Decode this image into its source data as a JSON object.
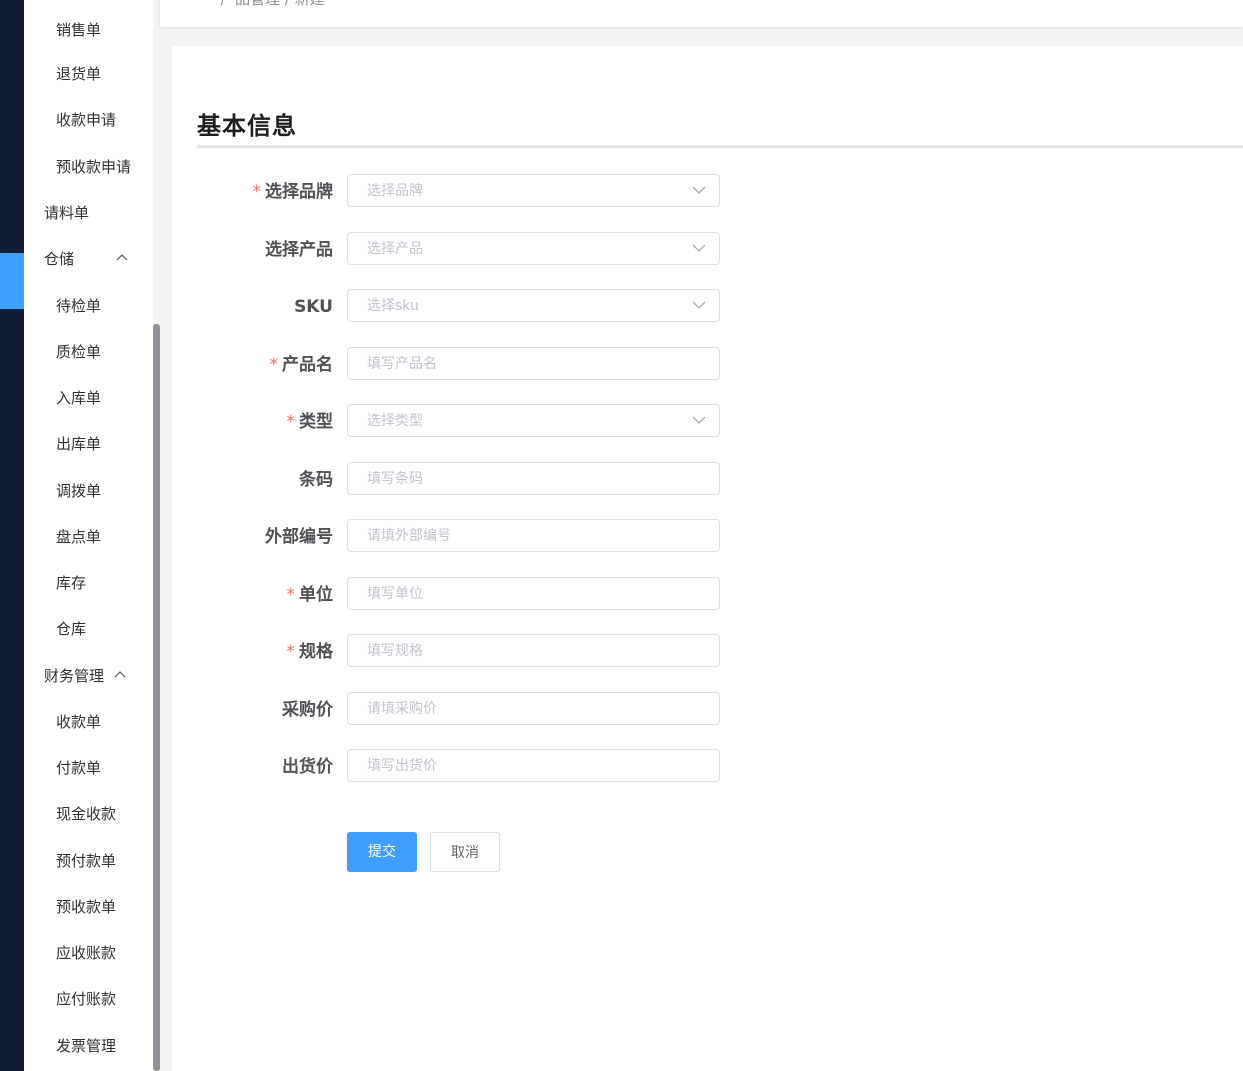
{
  "sidebar": {
    "items": [
      {
        "label": "销售单",
        "level": "sub"
      },
      {
        "label": "退货单",
        "level": "sub"
      },
      {
        "label": "收款申请",
        "level": "sub"
      },
      {
        "label": "预收款申请",
        "level": "sub"
      },
      {
        "label": "请料单",
        "level": "top"
      },
      {
        "label": "仓储",
        "level": "top",
        "expanded": true,
        "active": true
      },
      {
        "label": "待检单",
        "level": "sub"
      },
      {
        "label": "质检单",
        "level": "sub"
      },
      {
        "label": "入库单",
        "level": "sub"
      },
      {
        "label": "出库单",
        "level": "sub"
      },
      {
        "label": "调拨单",
        "level": "sub"
      },
      {
        "label": "盘点单",
        "level": "sub"
      },
      {
        "label": "库存",
        "level": "sub"
      },
      {
        "label": "仓库",
        "level": "sub"
      },
      {
        "label": "财务管理",
        "level": "top",
        "expanded": true
      },
      {
        "label": "收款单",
        "level": "sub"
      },
      {
        "label": "付款单",
        "level": "sub"
      },
      {
        "label": "现金收款",
        "level": "sub"
      },
      {
        "label": "预付款单",
        "level": "sub"
      },
      {
        "label": "预收款单",
        "level": "sub"
      },
      {
        "label": "应收账款",
        "level": "sub"
      },
      {
        "label": "应付账款",
        "level": "sub"
      },
      {
        "label": "发票管理",
        "level": "sub"
      }
    ]
  },
  "header": {
    "breadcrumb": "产品管理 / 新建"
  },
  "form": {
    "section_title": "基本信息",
    "fields": [
      {
        "label": "选择品牌",
        "placeholder": "选择品牌",
        "required": true,
        "type": "select"
      },
      {
        "label": "选择产品",
        "placeholder": "选择产品",
        "required": false,
        "type": "select"
      },
      {
        "label": "SKU",
        "placeholder": "选择sku",
        "required": false,
        "type": "select"
      },
      {
        "label": "产品名",
        "placeholder": "填写产品名",
        "required": true,
        "type": "input"
      },
      {
        "label": "类型",
        "placeholder": "选择类型",
        "required": true,
        "type": "select"
      },
      {
        "label": "条码",
        "placeholder": "填写条码",
        "required": false,
        "type": "input"
      },
      {
        "label": "外部编号",
        "placeholder": "请填外部编号",
        "required": false,
        "type": "input"
      },
      {
        "label": "单位",
        "placeholder": "填写单位",
        "required": true,
        "type": "input"
      },
      {
        "label": "规格",
        "placeholder": "填写规格",
        "required": true,
        "type": "input"
      },
      {
        "label": "采购价",
        "placeholder": "请填采购价",
        "required": false,
        "type": "input"
      },
      {
        "label": "出货价",
        "placeholder": "填写出货价",
        "required": false,
        "type": "input"
      }
    ],
    "required_mark": "*",
    "submit_label": "提交",
    "cancel_label": "取消"
  },
  "colors": {
    "primary": "#409eff",
    "rail": "#121b34",
    "required": "#f56c6c"
  }
}
